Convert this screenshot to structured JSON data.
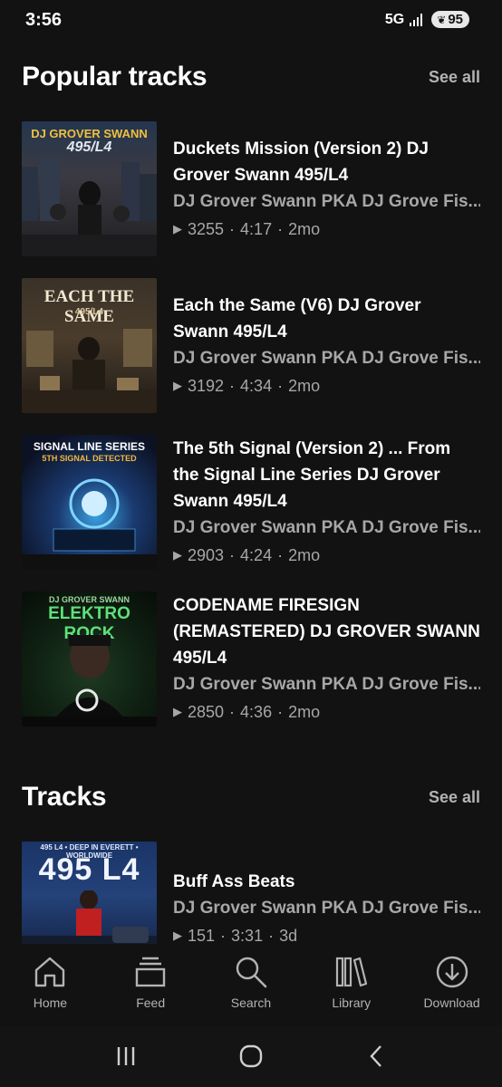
{
  "status": {
    "time": "3:56",
    "network": "5G",
    "battery": "95"
  },
  "popular": {
    "title": "Popular tracks",
    "see_all": "See all",
    "tracks": [
      {
        "title": "Duckets Mission (Version 2) DJ Grover Swann 495/L4",
        "artist": "DJ Grover Swann PKA DJ Grove Fis...",
        "plays": "3255",
        "duration": "4:17",
        "age": "2mo",
        "art_text": "DJ GROVER SWANN",
        "art_sub": "495/L4"
      },
      {
        "title": "Each the Same (V6) DJ Grover Swann 495/L4",
        "artist": "DJ Grover Swann PKA DJ Grove Fis...",
        "plays": "3192",
        "duration": "4:34",
        "age": "2mo",
        "art_text": "EACH THE SAME",
        "art_sub": "495/L4"
      },
      {
        "title": "The 5th Signal (Version 2) ... From the Signal Line Series DJ Grover Swann 495/L4",
        "artist": "DJ Grover Swann PKA DJ Grove Fis...",
        "plays": "2903",
        "duration": "4:24",
        "age": "2mo",
        "art_text": "SIGNAL LINE SERIES",
        "art_sub": "5TH SIGNAL DETECTED"
      },
      {
        "title": "CODENAME FIRESIGN (REMASTERED) DJ GROVER SWANN 495/L4",
        "artist": "DJ Grover Swann PKA DJ Grove Fis...",
        "plays": "2850",
        "duration": "4:36",
        "age": "2mo",
        "art_text": "ELEKTRO ROCK",
        "art_sub": "DJ GROVER SWANN"
      }
    ]
  },
  "tracks_section": {
    "title": "Tracks",
    "see_all": "See all",
    "tracks": [
      {
        "title": "Buff Ass Beats",
        "artist": "DJ Grover Swann PKA DJ Grove Fis...",
        "plays": "151",
        "duration": "3:31",
        "age": "3d",
        "art_text": "495 L4",
        "art_sub": "495 L4 • DEEP IN EVERETT • WORLDWIDE"
      }
    ]
  },
  "nav": {
    "home": "Home",
    "feed": "Feed",
    "search": "Search",
    "library": "Library",
    "download": "Download"
  },
  "colors": {
    "background": "#121212",
    "secondary_text": "#a7a7a7",
    "accent": "#ffffff"
  }
}
